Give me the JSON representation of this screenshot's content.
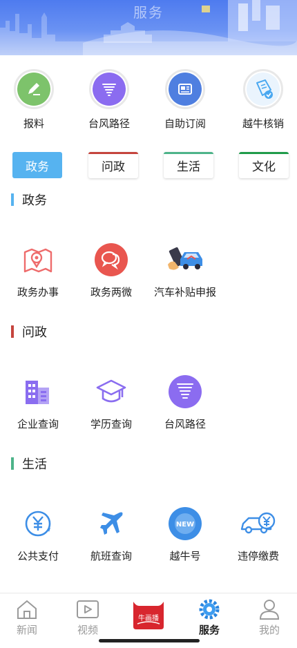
{
  "header": {
    "title": "服务"
  },
  "quick": [
    {
      "label": "报料",
      "icon": "pen-icon",
      "color": "#7dc36b"
    },
    {
      "label": "台风路径",
      "icon": "typhoon-icon",
      "color": "#8b6cf0"
    },
    {
      "label": "自助订阅",
      "icon": "newspaper-icon",
      "color": "#4f7fe0"
    },
    {
      "label": "越牛核销",
      "icon": "ticket-check-icon",
      "color": "#4aa8f0"
    }
  ],
  "tabs": [
    {
      "label": "政务",
      "active": true,
      "color": "#56b3f0"
    },
    {
      "label": "问政",
      "active": false,
      "color": "#c5443d"
    },
    {
      "label": "生活",
      "active": false,
      "color": "#4db389"
    },
    {
      "label": "文化",
      "active": false,
      "color": "#1f9b4a"
    }
  ],
  "sections": {
    "gov": {
      "title": "政务",
      "color": "#56b3f0",
      "items": [
        {
          "label": "政务办事",
          "icon": "map-pin-icon"
        },
        {
          "label": "政务两微",
          "icon": "chat-bubbles-icon"
        },
        {
          "label": "汽车补贴申报",
          "icon": "car-phone-icon"
        }
      ]
    },
    "ask": {
      "title": "问政",
      "color": "#c5443d",
      "items": [
        {
          "label": "企业查询",
          "icon": "building-icon"
        },
        {
          "label": "学历查询",
          "icon": "graduation-cap-icon"
        },
        {
          "label": "台风路径",
          "icon": "typhoon-icon"
        }
      ]
    },
    "life": {
      "title": "生活",
      "color": "#4db389",
      "items": [
        {
          "label": "公共支付",
          "icon": "yuan-payment-icon"
        },
        {
          "label": "航班查询",
          "icon": "airplane-icon"
        },
        {
          "label": "越牛号",
          "icon": "new-badge-icon"
        },
        {
          "label": "违停缴费",
          "icon": "car-yuan-icon"
        }
      ]
    }
  },
  "nav": [
    {
      "label": "新闻",
      "icon": "home-icon",
      "active": false
    },
    {
      "label": "视频",
      "icon": "video-icon",
      "active": false
    },
    {
      "label": "",
      "icon": "brand-logo-icon",
      "active": false
    },
    {
      "label": "服务",
      "icon": "gear-icon",
      "active": true
    },
    {
      "label": "我的",
      "icon": "user-icon",
      "active": false
    }
  ],
  "brand": {
    "logo_text": "牛画播"
  }
}
